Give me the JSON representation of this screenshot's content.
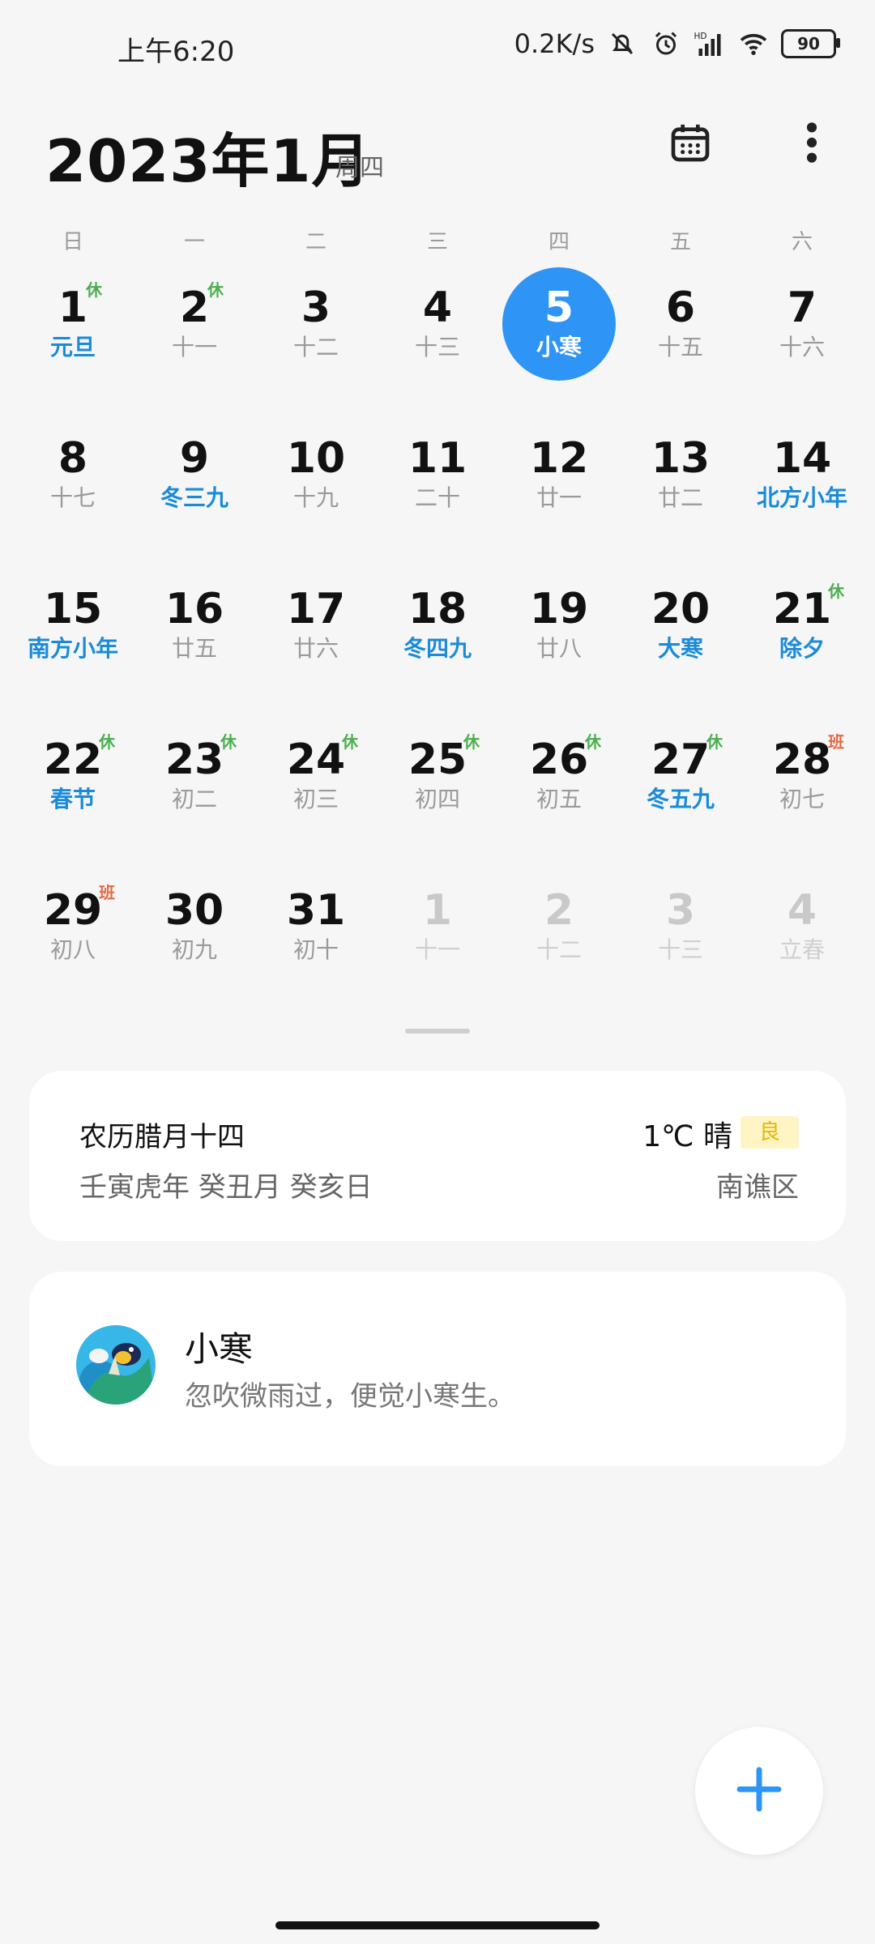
{
  "status_bar": {
    "time": "上午6:20",
    "net_speed": "0.2K/s",
    "battery": "90",
    "icons": [
      "mute-bell-icon",
      "alarm-icon",
      "hd-signal-icon",
      "wifi-icon",
      "battery-icon"
    ]
  },
  "header": {
    "month_title": "2023年1月",
    "weekday": "周四",
    "icons": [
      "calendar-icon",
      "more-vertical-icon"
    ]
  },
  "weekdays": [
    "日",
    "一",
    "二",
    "三",
    "四",
    "五",
    "六"
  ],
  "weeks": [
    [
      {
        "num": "1",
        "sub": "元旦",
        "festival": true,
        "badge": "休",
        "badge_type": "rest"
      },
      {
        "num": "2",
        "sub": "十一",
        "badge": "休",
        "badge_type": "rest"
      },
      {
        "num": "3",
        "sub": "十二"
      },
      {
        "num": "4",
        "sub": "十三"
      },
      {
        "num": "5",
        "sub": "小寒",
        "today": true
      },
      {
        "num": "6",
        "sub": "十五"
      },
      {
        "num": "7",
        "sub": "十六"
      }
    ],
    [
      {
        "num": "8",
        "sub": "十七"
      },
      {
        "num": "9",
        "sub": "冬三九",
        "festival": true
      },
      {
        "num": "10",
        "sub": "十九"
      },
      {
        "num": "11",
        "sub": "二十"
      },
      {
        "num": "12",
        "sub": "廿一"
      },
      {
        "num": "13",
        "sub": "廿二"
      },
      {
        "num": "14",
        "sub": "北方小年",
        "festival": true
      }
    ],
    [
      {
        "num": "15",
        "sub": "南方小年",
        "festival": true
      },
      {
        "num": "16",
        "sub": "廿五"
      },
      {
        "num": "17",
        "sub": "廿六"
      },
      {
        "num": "18",
        "sub": "冬四九",
        "festival": true
      },
      {
        "num": "19",
        "sub": "廿八"
      },
      {
        "num": "20",
        "sub": "大寒",
        "festival": true
      },
      {
        "num": "21",
        "sub": "除夕",
        "festival": true,
        "badge": "休",
        "badge_type": "rest"
      }
    ],
    [
      {
        "num": "22",
        "sub": "春节",
        "festival": true,
        "badge": "休",
        "badge_type": "rest"
      },
      {
        "num": "23",
        "sub": "初二",
        "badge": "休",
        "badge_type": "rest"
      },
      {
        "num": "24",
        "sub": "初三",
        "badge": "休",
        "badge_type": "rest"
      },
      {
        "num": "25",
        "sub": "初四",
        "badge": "休",
        "badge_type": "rest"
      },
      {
        "num": "26",
        "sub": "初五",
        "badge": "休",
        "badge_type": "rest"
      },
      {
        "num": "27",
        "sub": "冬五九",
        "festival": true,
        "badge": "休",
        "badge_type": "rest"
      },
      {
        "num": "28",
        "sub": "初七",
        "badge": "班",
        "badge_type": "work"
      }
    ],
    [
      {
        "num": "29",
        "sub": "初八",
        "badge": "班",
        "badge_type": "work"
      },
      {
        "num": "30",
        "sub": "初九"
      },
      {
        "num": "31",
        "sub": "初十"
      },
      {
        "num": "1",
        "sub": "十一",
        "outside": true
      },
      {
        "num": "2",
        "sub": "十二",
        "outside": true
      },
      {
        "num": "3",
        "sub": "十三",
        "outside": true
      },
      {
        "num": "4",
        "sub": "立春",
        "outside": true
      }
    ]
  ],
  "info_card": {
    "lunar_date": "农历腊月十四",
    "ganzhi": "壬寅虎年 癸丑月 癸亥日",
    "weather": "1℃ 晴",
    "aqi": "良",
    "district": "南谯区"
  },
  "term_card": {
    "title": "小寒",
    "poem": "忽吹微雨过，便觉小寒生。"
  },
  "colors": {
    "accent": "#2e94f5",
    "festival": "#1a8bd9",
    "rest_badge": "#4caf50",
    "work_badge": "#e26a45"
  }
}
